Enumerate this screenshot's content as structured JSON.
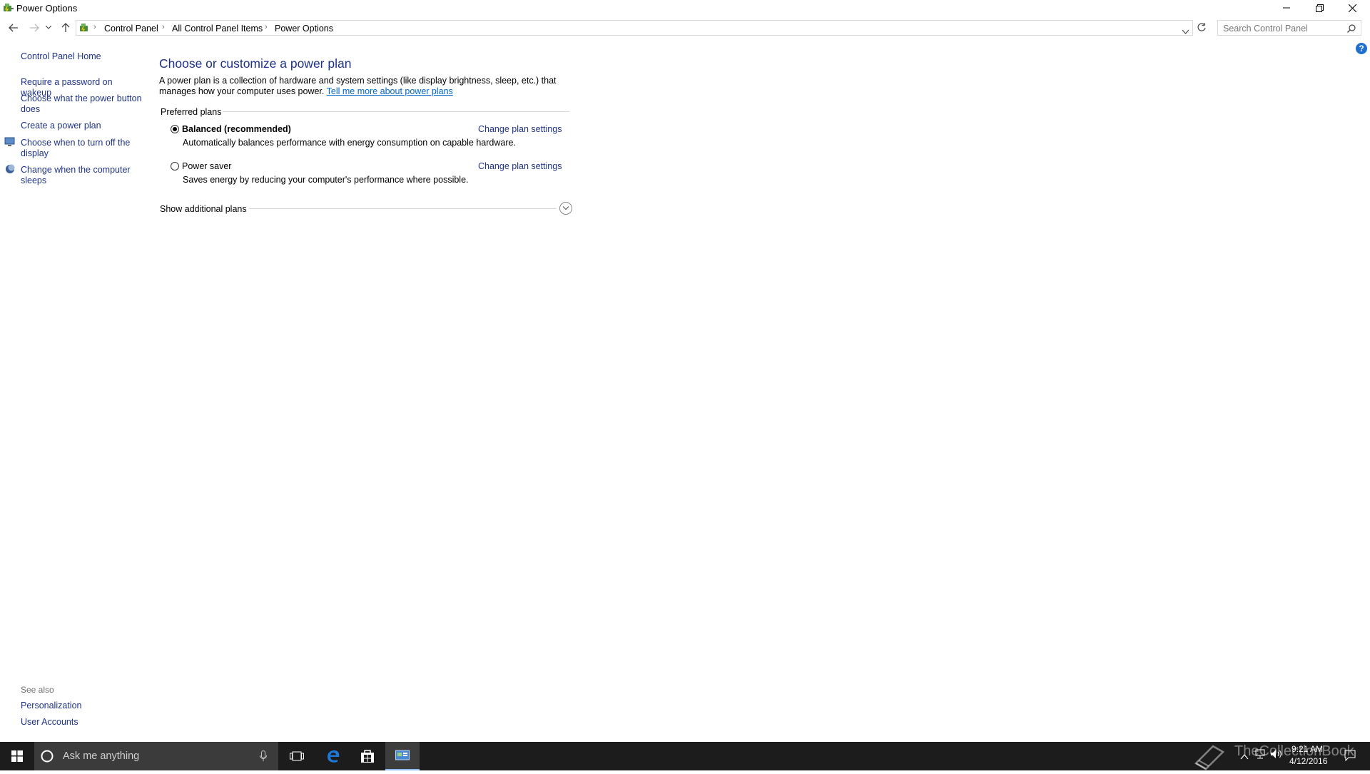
{
  "window": {
    "title": "Power Options"
  },
  "address": {
    "breadcrumb": [
      "Control Panel",
      "All Control Panel Items",
      "Power Options"
    ],
    "search_placeholder": "Search Control Panel"
  },
  "sidebar": {
    "home": "Control Panel Home",
    "items": [
      {
        "label": "Require a password on wakeup",
        "icon": "none"
      },
      {
        "label": "Choose what the power button does",
        "icon": "none"
      },
      {
        "label": "Create a power plan",
        "icon": "none"
      },
      {
        "label": "Choose when to turn off the display",
        "icon": "monitor-icon"
      },
      {
        "label": "Change when the computer sleeps",
        "icon": "moon-icon"
      }
    ],
    "see_also_label": "See also",
    "see_also": [
      "Personalization",
      "User Accounts"
    ]
  },
  "main": {
    "title": "Choose or customize a power plan",
    "description": "A power plan is a collection of hardware and system settings (like display brightness, sleep, etc.) that manages how your computer uses power.",
    "description_link": "Tell me more about power plans",
    "preferred_label": "Preferred plans",
    "plans": [
      {
        "name": "Balanced (recommended)",
        "description": "Automatically balances performance with energy consumption on capable hardware.",
        "link": "Change plan settings",
        "selected": true
      },
      {
        "name": "Power saver",
        "description": "Saves energy by reducing your computer's performance where possible.",
        "link": "Change plan settings",
        "selected": false
      }
    ],
    "show_additional": "Show additional plans"
  },
  "taskbar": {
    "search_text": "Ask me anything",
    "time": "9:21 AM",
    "date": "4/12/2016",
    "watermark": "TheCollectionBook"
  },
  "colors": {
    "link_blue": "#1e3287",
    "taskbar": "#1c1c1c",
    "accent": "#1e6fd0"
  }
}
